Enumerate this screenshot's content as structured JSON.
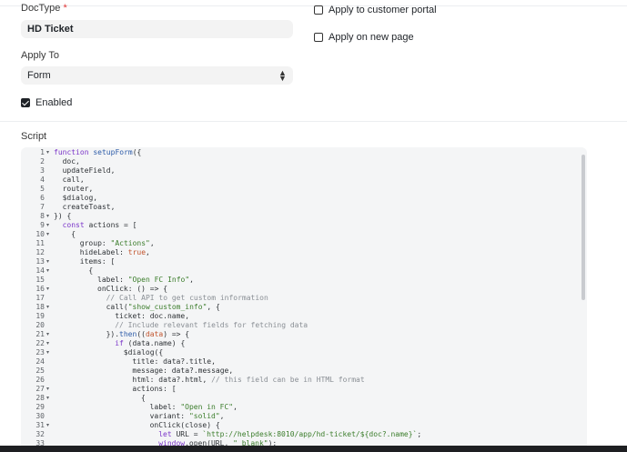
{
  "form": {
    "doctype_label": "DocType",
    "doctype_required": "*",
    "doctype_value": "HD Ticket",
    "apply_to_label": "Apply To",
    "apply_to_value": "Form",
    "enabled_label": "Enabled",
    "enabled_checked": true,
    "customer_portal_label": "Apply to customer portal",
    "customer_portal_checked": false,
    "new_page_label": "Apply on new page",
    "new_page_checked": false,
    "script_label": "Script"
  },
  "editor": {
    "lines": [
      {
        "n": "1",
        "fold": true,
        "indent": 0,
        "tokens": [
          [
            "kw",
            "function "
          ],
          [
            "fn",
            "setupForm"
          ],
          [
            "",
            "({"
          ]
        ]
      },
      {
        "n": "2",
        "fold": false,
        "indent": 1,
        "tokens": [
          [
            "",
            "doc,"
          ]
        ]
      },
      {
        "n": "3",
        "fold": false,
        "indent": 1,
        "tokens": [
          [
            "",
            "updateField,"
          ]
        ]
      },
      {
        "n": "4",
        "fold": false,
        "indent": 1,
        "tokens": [
          [
            "",
            "call,"
          ]
        ]
      },
      {
        "n": "5",
        "fold": false,
        "indent": 1,
        "tokens": [
          [
            "",
            "router,"
          ]
        ]
      },
      {
        "n": "6",
        "fold": false,
        "indent": 1,
        "tokens": [
          [
            "",
            "$dialog,"
          ]
        ]
      },
      {
        "n": "7",
        "fold": false,
        "indent": 1,
        "tokens": [
          [
            "",
            "createToast,"
          ]
        ]
      },
      {
        "n": "8",
        "fold": true,
        "indent": 0,
        "tokens": [
          [
            "",
            "}) {"
          ]
        ]
      },
      {
        "n": "9",
        "fold": true,
        "indent": 1,
        "tokens": [
          [
            "kw",
            "const "
          ],
          [
            "",
            "actions = ["
          ]
        ]
      },
      {
        "n": "10",
        "fold": true,
        "indent": 2,
        "tokens": [
          [
            "",
            "{"
          ]
        ]
      },
      {
        "n": "11",
        "fold": false,
        "indent": 3,
        "tokens": [
          [
            "",
            "group: "
          ],
          [
            "str",
            "\"Actions\""
          ],
          [
            "",
            ","
          ]
        ]
      },
      {
        "n": "12",
        "fold": false,
        "indent": 3,
        "tokens": [
          [
            "",
            "hideLabel: "
          ],
          [
            "bool",
            "true"
          ],
          [
            "",
            ","
          ]
        ]
      },
      {
        "n": "13",
        "fold": true,
        "indent": 3,
        "tokens": [
          [
            "",
            "items: ["
          ]
        ]
      },
      {
        "n": "14",
        "fold": true,
        "indent": 4,
        "tokens": [
          [
            "",
            "{"
          ]
        ]
      },
      {
        "n": "15",
        "fold": false,
        "indent": 5,
        "tokens": [
          [
            "",
            "label: "
          ],
          [
            "str",
            "\"Open FC Info\""
          ],
          [
            "",
            ","
          ]
        ]
      },
      {
        "n": "16",
        "fold": true,
        "indent": 5,
        "tokens": [
          [
            "",
            "onClick: () => {"
          ]
        ]
      },
      {
        "n": "17",
        "fold": false,
        "indent": 6,
        "tokens": [
          [
            "cm",
            "// Call API to get custom information"
          ]
        ]
      },
      {
        "n": "18",
        "fold": true,
        "indent": 6,
        "tokens": [
          [
            "",
            "call("
          ],
          [
            "str",
            "\"show_custom_info\""
          ],
          [
            "",
            ", {"
          ]
        ]
      },
      {
        "n": "19",
        "fold": false,
        "indent": 7,
        "tokens": [
          [
            "",
            "ticket: doc.name,"
          ]
        ]
      },
      {
        "n": "20",
        "fold": false,
        "indent": 7,
        "tokens": [
          [
            "cm",
            "// Include relevant fields for fetching data"
          ]
        ]
      },
      {
        "n": "21",
        "fold": true,
        "indent": 6,
        "tokens": [
          [
            "",
            "})."
          ],
          [
            "fn",
            "then"
          ],
          [
            "",
            "(("
          ],
          [
            "tp",
            "data"
          ],
          [
            "",
            ") => {"
          ]
        ]
      },
      {
        "n": "22",
        "fold": true,
        "indent": 7,
        "tokens": [
          [
            "kw",
            "if "
          ],
          [
            "",
            "(data.name) {"
          ]
        ]
      },
      {
        "n": "23",
        "fold": true,
        "indent": 8,
        "tokens": [
          [
            "",
            "$dialog({"
          ]
        ]
      },
      {
        "n": "24",
        "fold": false,
        "indent": 9,
        "tokens": [
          [
            "",
            "title: data?.title,"
          ]
        ]
      },
      {
        "n": "25",
        "fold": false,
        "indent": 9,
        "tokens": [
          [
            "",
            "message: data?.message,"
          ]
        ]
      },
      {
        "n": "26",
        "fold": false,
        "indent": 9,
        "tokens": [
          [
            "",
            "html: data?.html, "
          ],
          [
            "cm",
            "// this field can be in HTML format"
          ]
        ]
      },
      {
        "n": "27",
        "fold": true,
        "indent": 9,
        "tokens": [
          [
            "",
            "actions: ["
          ]
        ]
      },
      {
        "n": "28",
        "fold": true,
        "indent": 10,
        "tokens": [
          [
            "",
            "{"
          ]
        ]
      },
      {
        "n": "29",
        "fold": false,
        "indent": 11,
        "tokens": [
          [
            "",
            "label: "
          ],
          [
            "str",
            "\"Open in FC\""
          ],
          [
            "",
            ","
          ]
        ]
      },
      {
        "n": "30",
        "fold": false,
        "indent": 11,
        "tokens": [
          [
            "",
            "variant: "
          ],
          [
            "str",
            "\"solid\""
          ],
          [
            "",
            ","
          ]
        ]
      },
      {
        "n": "31",
        "fold": true,
        "indent": 11,
        "tokens": [
          [
            "",
            "onClick(close) {"
          ]
        ]
      },
      {
        "n": "32",
        "fold": false,
        "indent": 12,
        "tokens": [
          [
            "kw",
            "let "
          ],
          [
            "",
            "URL = "
          ],
          [
            "str",
            "`http://helpdesk:8010/app/hd-ticket/${doc?.name}`"
          ],
          [
            "",
            ";"
          ]
        ]
      },
      {
        "n": "33",
        "fold": false,
        "indent": 12,
        "tokens": [
          [
            "kw",
            "window"
          ],
          [
            "",
            ".open(URL, "
          ],
          [
            "str",
            "\"_blank\""
          ],
          [
            "",
            ");"
          ]
        ]
      }
    ]
  }
}
